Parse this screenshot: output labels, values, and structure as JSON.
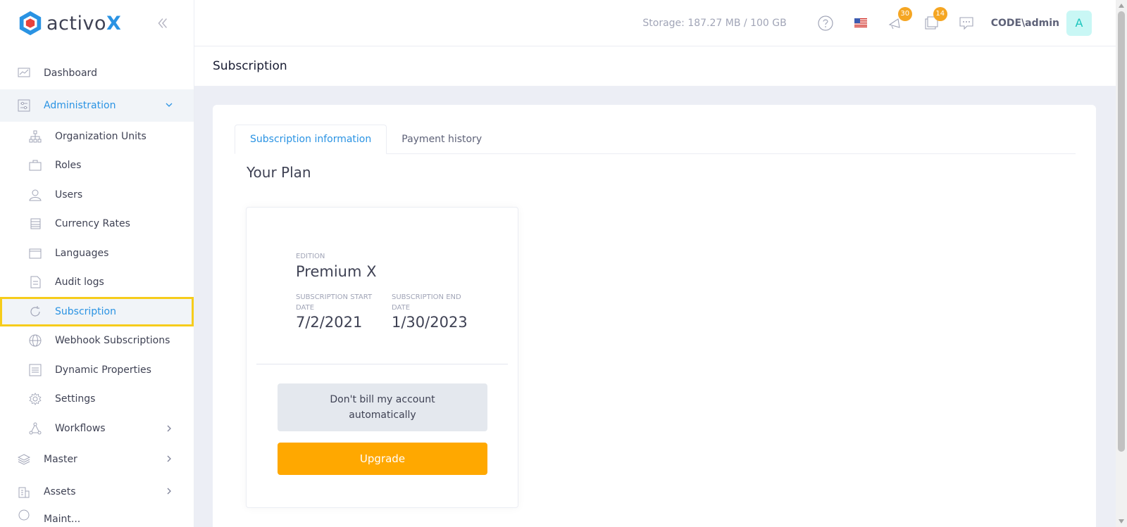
{
  "brand": {
    "name": "activo",
    "suffix": "X"
  },
  "topbar": {
    "storage": "Storage: 187.27 MB / 100 GB",
    "notifications_count": "30",
    "tasks_count": "14",
    "username": "CODE\\admin",
    "avatar_letter": "A"
  },
  "sidebar": {
    "items": [
      {
        "label": "Dashboard",
        "icon": "chart-icon"
      },
      {
        "label": "Administration",
        "icon": "sliders-icon"
      },
      {
        "label": "Master",
        "icon": "layers-icon"
      },
      {
        "label": "Assets",
        "icon": "building-icon"
      }
    ],
    "admin_sub": [
      {
        "label": "Organization Units",
        "icon": "org-tree-icon"
      },
      {
        "label": "Roles",
        "icon": "briefcase-icon"
      },
      {
        "label": "Users",
        "icon": "user-icon"
      },
      {
        "label": "Currency Rates",
        "icon": "coins-icon"
      },
      {
        "label": "Languages",
        "icon": "window-icon"
      },
      {
        "label": "Audit logs",
        "icon": "document-icon"
      },
      {
        "label": "Subscription",
        "icon": "refresh-icon"
      },
      {
        "label": "Webhook Subscriptions",
        "icon": "globe-icon"
      },
      {
        "label": "Dynamic Properties",
        "icon": "list-icon"
      },
      {
        "label": "Settings",
        "icon": "gear-icon"
      },
      {
        "label": "Workflows",
        "icon": "workflow-icon"
      }
    ],
    "cut_off_label": "Maint..."
  },
  "page": {
    "title": "Subscription"
  },
  "tabs": [
    {
      "label": "Subscription information"
    },
    {
      "label": "Payment history"
    }
  ],
  "plan": {
    "heading": "Your Plan",
    "edition_label": "EDITION",
    "edition_value": "Premium X",
    "start_label": "SUBSCRIPTION START DATE",
    "start_value": "7/2/2021",
    "end_label": "SUBSCRIPTION END DATE",
    "end_value": "1/30/2023",
    "no_bill_label": "Don't bill my account automatically",
    "upgrade_label": "Upgrade"
  },
  "colors": {
    "accent": "#2a93e3",
    "upgrade": "#ffa800",
    "highlight": "#f6cc1b",
    "badge": "#f5a623"
  }
}
